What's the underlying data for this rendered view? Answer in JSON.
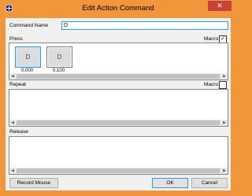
{
  "window": {
    "title": "Edit Action Command",
    "close_glyph": "✕"
  },
  "command_name": {
    "label": "Command Name",
    "value": "D"
  },
  "press": {
    "label": "Press",
    "macro_label": "Macro",
    "macro_checked": true,
    "keys": [
      {
        "key": "D",
        "time": "0,000"
      },
      {
        "key": "D",
        "time": "0,100"
      }
    ]
  },
  "repeat": {
    "label": "Repeat",
    "macro_label": "Macro",
    "macro_checked": false
  },
  "release": {
    "label": "Release"
  },
  "buttons": {
    "record_mouse": "Record Mouse",
    "ok": "OK",
    "cancel": "Cancel"
  },
  "icons": {
    "app": "crosshair-icon",
    "close": "close-icon",
    "check": "check-icon"
  },
  "colors": {
    "title_bar": "#f2963c",
    "close_button": "#c8413a",
    "focus": "#3399ff"
  }
}
